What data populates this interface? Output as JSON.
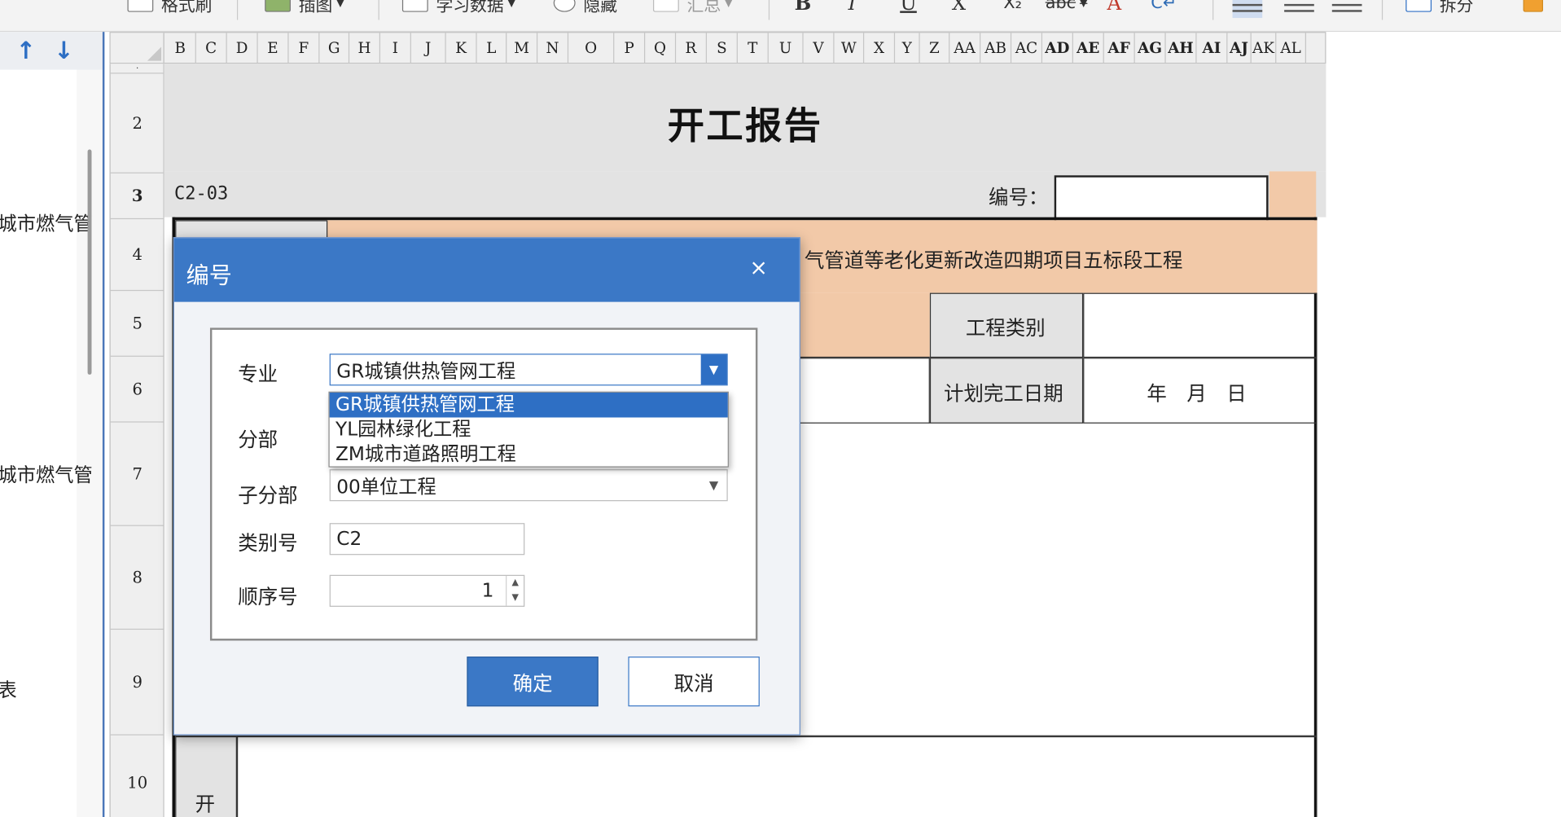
{
  "toolbar": {
    "format_painter": "格式刷",
    "insert_image": "插图",
    "learn_data": "学习数据",
    "hide": "隐藏",
    "summary": "汇总",
    "split": "拆分",
    "bold": "B",
    "italic": "I",
    "underline": "U",
    "clear": "X",
    "subscript": "X₂",
    "strike": "abc",
    "font_color": "A",
    "wrap": "C↵"
  },
  "nav": {
    "up_arrow": "↑",
    "down_arrow": "↓",
    "items": [
      "城市燃气管",
      "城市燃气管",
      "表"
    ]
  },
  "sheet": {
    "columns": [
      "B",
      "C",
      "D",
      "E",
      "F",
      "G",
      "H",
      "I",
      "J",
      "K",
      "L",
      "M",
      "N",
      "O",
      "P",
      "Q",
      "R",
      "S",
      "T",
      "U",
      "V",
      "W",
      "X",
      "Y",
      "Z",
      "AA",
      "AB",
      "AC",
      "AD",
      "AE",
      "AF",
      "AG",
      "AH",
      "AI",
      "AJ",
      "AK",
      "AL"
    ],
    "rows": [
      "2",
      "3",
      "4",
      "5",
      "6",
      "7",
      "8",
      "9",
      "10"
    ],
    "title": "开工报告",
    "code": "C2-03",
    "number_label": "编号：",
    "project_name": "气管道等老化更新改造四期项目五标段工程",
    "project_type_label": "工程类别",
    "planned_completion_label": "计划完工日期",
    "date_placeholder": "年　月　日",
    "start_char": "开"
  },
  "dialog": {
    "title": "编号",
    "close": "×",
    "labels": {
      "specialty": "专业",
      "division": "分部",
      "subdivision": "子分部",
      "category_no": "类别号",
      "sequence_no": "顺序号"
    },
    "specialty_value": "GR城镇供热管网工程",
    "specialty_options": [
      "GR城镇供热管网工程",
      "YL园林绿化工程",
      "ZM城市道路照明工程"
    ],
    "subdivision_value": "00单位工程",
    "category_no_value": "C2",
    "sequence_no_value": "1",
    "ok": "确定",
    "cancel": "取消"
  },
  "colors": {
    "accent": "#3b78c6",
    "selection": "#2e6fc4",
    "peach": "#f2c9a8",
    "header_gray": "#e3e3e3"
  }
}
